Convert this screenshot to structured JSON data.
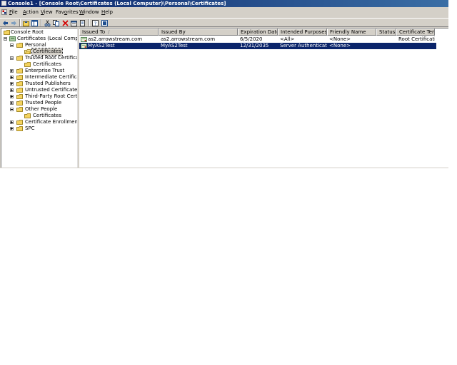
{
  "window": {
    "title": "Console1 - [Console Root\\Certificates (Local Computer)\\Personal\\Certificates]"
  },
  "menu": {
    "items": [
      {
        "id": "file",
        "pre": "",
        "accel": "F",
        "rest": "ile"
      },
      {
        "id": "action",
        "pre": "",
        "accel": "A",
        "rest": "ction"
      },
      {
        "id": "view",
        "pre": "",
        "accel": "V",
        "rest": "iew"
      },
      {
        "id": "favorites",
        "pre": "Fav",
        "accel": "o",
        "rest": "rites"
      },
      {
        "id": "window",
        "pre": "",
        "accel": "W",
        "rest": "indow"
      },
      {
        "id": "help",
        "pre": "",
        "accel": "H",
        "rest": "elp"
      }
    ]
  },
  "toolbar": {
    "buttons": [
      "back-arrow-icon",
      "forward-arrow-icon",
      "up-folder-icon",
      "show-tree-icon",
      "cut-icon",
      "copy-icon",
      "delete-icon",
      "properties-icon",
      "export-list-icon",
      "help-icon",
      "mmc-console-icon"
    ]
  },
  "tree": {
    "nodes": [
      {
        "label": "Console Root",
        "level": 0,
        "expander": "none",
        "icon": "folder-icon"
      },
      {
        "label": "Certificates (Local Computer)",
        "level": 1,
        "expander": "minus",
        "icon": "certificate-store-icon"
      },
      {
        "label": "Personal",
        "level": 2,
        "expander": "minus",
        "icon": "folder-icon"
      },
      {
        "label": "Certificates",
        "level": 3,
        "expander": "none",
        "icon": "open-folder-icon",
        "selected": true
      },
      {
        "label": "Trusted Root Certification Authorities",
        "level": 2,
        "expander": "minus",
        "icon": "folder-icon"
      },
      {
        "label": "Certificates",
        "level": 3,
        "expander": "none",
        "icon": "folder-icon"
      },
      {
        "label": "Enterprise Trust",
        "level": 2,
        "expander": "plus",
        "icon": "folder-icon"
      },
      {
        "label": "Intermediate Certification Authorities",
        "level": 2,
        "expander": "plus",
        "icon": "folder-icon"
      },
      {
        "label": "Trusted Publishers",
        "level": 2,
        "expander": "plus",
        "icon": "folder-icon"
      },
      {
        "label": "Untrusted Certificates",
        "level": 2,
        "expander": "plus",
        "icon": "folder-icon"
      },
      {
        "label": "Third-Party Root Certification Authorities",
        "level": 2,
        "expander": "plus",
        "icon": "folder-icon"
      },
      {
        "label": "Trusted People",
        "level": 2,
        "expander": "plus",
        "icon": "folder-icon"
      },
      {
        "label": "Other People",
        "level": 2,
        "expander": "minus",
        "icon": "folder-icon"
      },
      {
        "label": "Certificates",
        "level": 3,
        "expander": "none",
        "icon": "folder-icon"
      },
      {
        "label": "Certificate Enrollment Requests",
        "level": 2,
        "expander": "plus",
        "icon": "folder-icon"
      },
      {
        "label": "SPC",
        "level": 2,
        "expander": "plus",
        "icon": "folder-icon"
      }
    ]
  },
  "list": {
    "columns": [
      {
        "key": "issued_to",
        "label": "Issued To",
        "sorted": true
      },
      {
        "key": "issued_by",
        "label": "Issued By"
      },
      {
        "key": "expiration",
        "label": "Expiration Date"
      },
      {
        "key": "purposes",
        "label": "Intended Purposes"
      },
      {
        "key": "friendly",
        "label": "Friendly Name"
      },
      {
        "key": "status",
        "label": "Status"
      },
      {
        "key": "template",
        "label": "Certificate Template"
      }
    ],
    "rows": [
      {
        "issued_to": "as2.arrowstream.com",
        "issued_by": "as2.arrowstream.com",
        "expiration": "6/5/2020",
        "purposes": "<All>",
        "friendly": "<None>",
        "status": "",
        "template": "Root Certification Authority",
        "selected": false
      },
      {
        "issued_to": "MyAS2Test",
        "issued_by": "MyAS2Test",
        "expiration": "12/31/2035",
        "purposes": "Server Authentication",
        "friendly": "<None>",
        "status": "",
        "template": "",
        "selected": true
      }
    ],
    "sort_arrow": "/"
  },
  "colors": {
    "title_active": "#0a246a",
    "chrome": "#d4d0c8",
    "selection": "#0a246a"
  }
}
